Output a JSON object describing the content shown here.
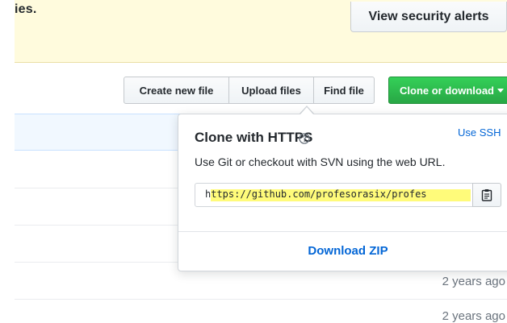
{
  "banner": {
    "text": "ies.",
    "view_security_alerts_label": "View security alerts"
  },
  "file_actions": {
    "create_new_file_label": "Create new file",
    "upload_files_label": "Upload files",
    "find_file_label": "Find file",
    "clone_or_download_label": "Clone or download"
  },
  "file_list": {
    "ages": [
      "2 years ago",
      "2 years ago"
    ]
  },
  "clone_popover": {
    "title": "Clone with HTTPS",
    "use_ssh_label": "Use SSH",
    "description": "Use Git or checkout with SVN using the web URL.",
    "url": "https://github.com/profesorasix/profes",
    "copy_icon": "clipboard-icon",
    "help_icon": "question-circle-icon",
    "download_zip_label": "Download ZIP"
  },
  "colors": {
    "banner_bg": "#fffbdd",
    "clone_button_green": "#28a745",
    "link_blue": "#0366d6",
    "url_highlight": "#fffb7a",
    "list_header_bg": "#f1f8ff"
  }
}
